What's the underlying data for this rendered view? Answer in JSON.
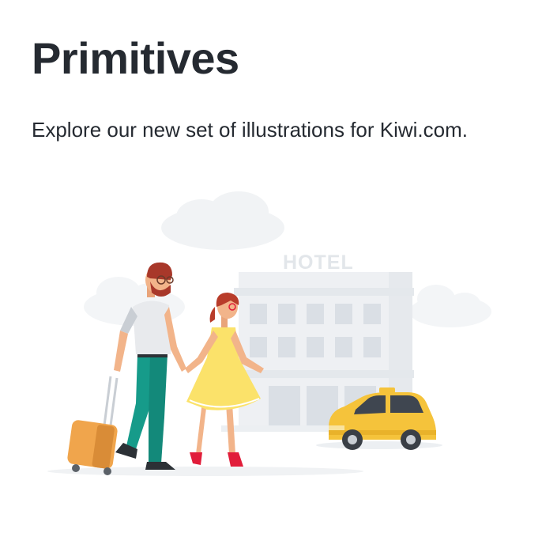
{
  "page": {
    "title": "Primitives",
    "description": "Explore our new set of illustrations for Kiwi.com."
  },
  "illustration": {
    "sign_text": "HOTEL",
    "colors": {
      "cloud": "#f1f3f5",
      "hotel": "#eef0f3",
      "hotel_window": "#d9dee4",
      "taxi": "#f5c33b",
      "dress": "#fbe26a",
      "trousers": "#169b8a",
      "suitcase": "#f0a54c",
      "hair": "#b83c2a",
      "heels": "#e11d3a"
    }
  }
}
